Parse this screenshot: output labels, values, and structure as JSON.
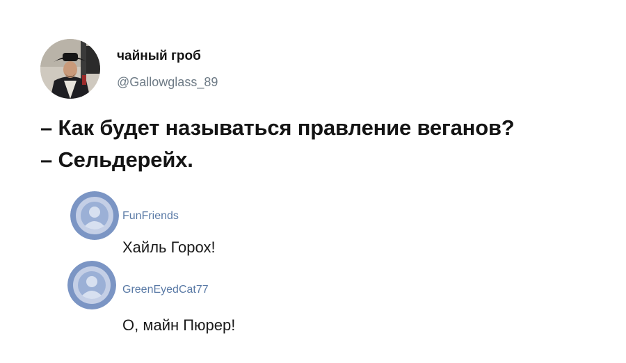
{
  "tweet": {
    "author_name": "чайный гроб",
    "author_handle": "@Gallowglass_89",
    "avatar_icon": "pirate-portrait-avatar",
    "lines": [
      "– Как будет называться правление веганов?",
      "– Сельдерейх."
    ]
  },
  "comments": [
    {
      "username": "FunFriends",
      "text": "Хайль Горох!",
      "avatar_icon": "default-user-avatar",
      "avatar_color": "#7b95c4"
    },
    {
      "username": "GreenEyedCat77",
      "text": "О, майн Пюрер!",
      "avatar_icon": "default-user-avatar",
      "avatar_color": "#7b95c4"
    }
  ],
  "colors": {
    "handle": "#6e7b86",
    "comment_username": "#5a7aa6",
    "text": "#141414"
  }
}
